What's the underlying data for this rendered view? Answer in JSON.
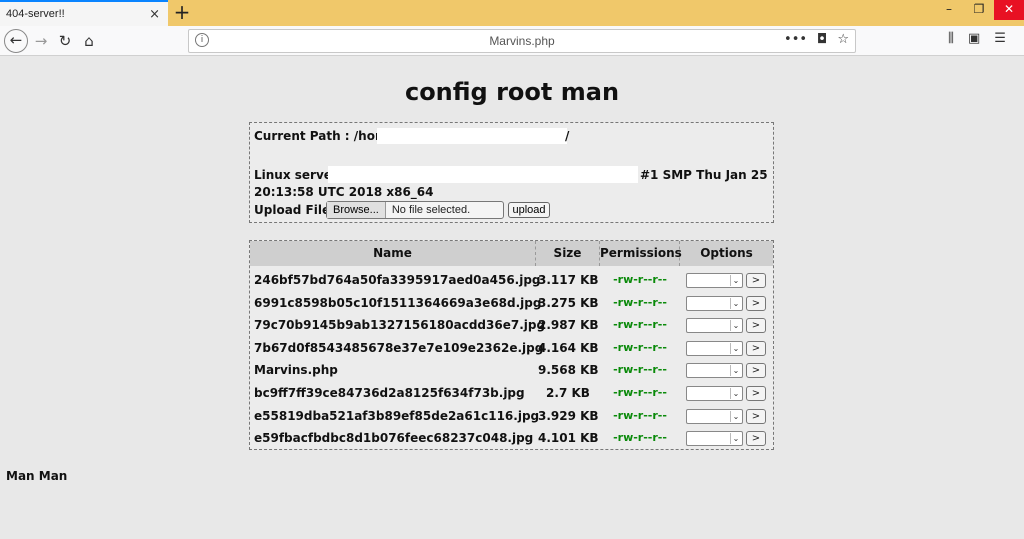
{
  "browser": {
    "tab_title": "404-server!!",
    "tab_close": "×",
    "new_tab": "+",
    "url": "Marvins.php",
    "window_controls": [
      "–",
      "❐",
      "✕"
    ]
  },
  "page": {
    "title": "config root man",
    "current_path_label": "Current Path : /home/",
    "current_path_suffix": "/",
    "uname_prefix": "Linux server.",
    "uname_suffix": "#1 SMP Thu Jan 25",
    "uname_line2": "20:13:58 UTC 2018 x86_64",
    "upload_label": "Upload File :",
    "browse_label": "Browse...",
    "file_status": "No file selected.",
    "upload_button": "upload",
    "footer": "Man Man"
  },
  "table": {
    "headers": [
      "Name",
      "Size",
      "Permissions",
      "Options"
    ],
    "rows": [
      {
        "name": "246bf57bd764a50fa3395917aed0a456.jpg",
        "size": "3.117 KB",
        "perm": "-rw-r--r--"
      },
      {
        "name": "6991c8598b05c10f1511364669a3e68d.jpg",
        "size": "3.275 KB",
        "perm": "-rw-r--r--"
      },
      {
        "name": "79c70b9145b9ab1327156180acdd36e7.jpg",
        "size": "2.987 KB",
        "perm": "-rw-r--r--"
      },
      {
        "name": "7b67d0f8543485678e37e7e109e2362e.jpg",
        "size": "4.164 KB",
        "perm": "-rw-r--r--"
      },
      {
        "name": "Marvins.php",
        "size": "9.568 KB",
        "perm": "-rw-r--r--"
      },
      {
        "name": "bc9ff7ff39ce84736d2a8125f634f73b.jpg",
        "size": "2.7 KB",
        "perm": "-rw-r--r--"
      },
      {
        "name": "e55819dba521af3b89ef85de2a61c116.jpg",
        "size": "3.929 KB",
        "perm": "-rw-r--r--"
      },
      {
        "name": "e59fbacfbdbc8d1b076feec68237c048.jpg",
        "size": "4.101 KB",
        "perm": "-rw-r--r--"
      }
    ],
    "go_label": ">",
    "select_arrow": "⌄"
  },
  "colors": {
    "tab_strip": "#f0c86a",
    "permission_green": "#0a8a0a",
    "page_background": "#e8e8e8"
  }
}
